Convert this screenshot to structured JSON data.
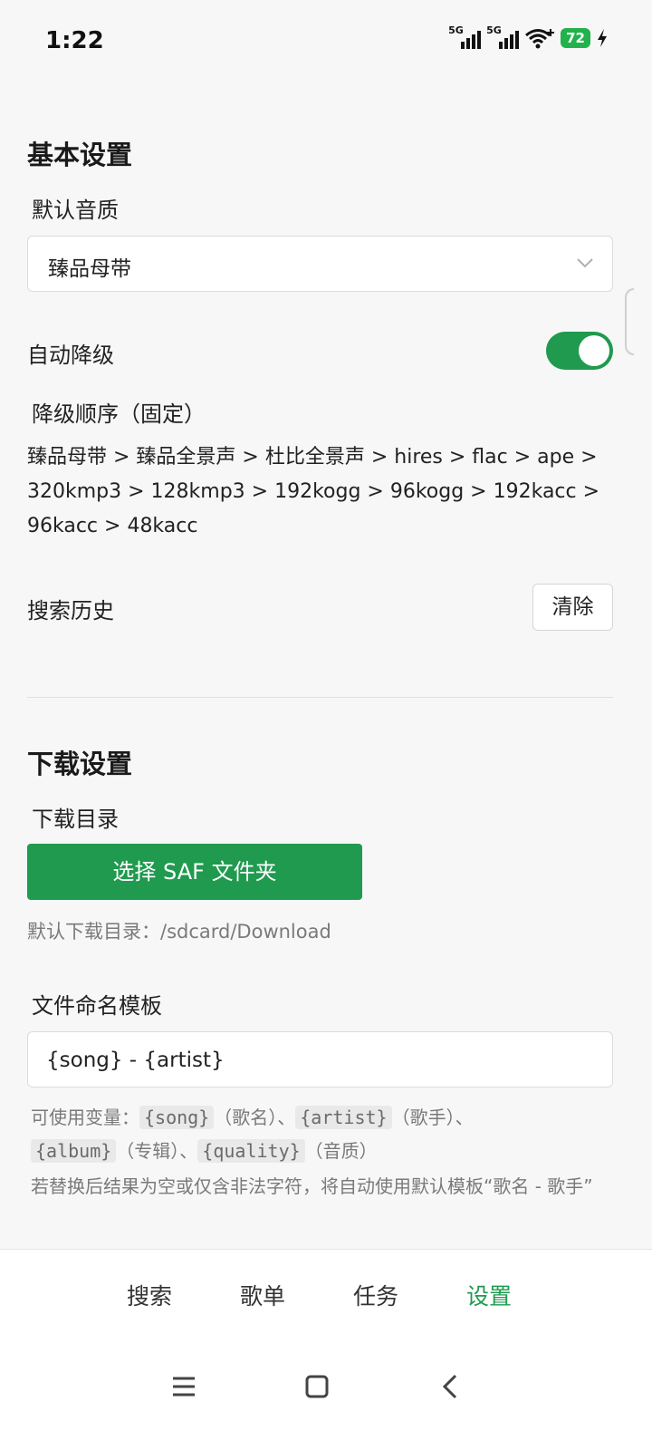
{
  "status_bar": {
    "time": "1:22",
    "sim1": "5G",
    "sim2": "5G",
    "battery": "72",
    "accent": "#21b24b"
  },
  "basic": {
    "title": "基本设置",
    "quality_label": "默认音质",
    "quality_value": "臻品母带",
    "auto_downgrade_label": "自动降级",
    "auto_downgrade_on": true,
    "downgrade_order_label": "降级顺序（固定）",
    "downgrade_order_lines": [
      "臻品母带 > 臻品全景声 > 杜比全景声 > hires > flac > ape >",
      "320kmp3 > 128kmp3 > 192kogg > 96kogg > 192kacc >",
      "96kacc > 48kacc"
    ],
    "search_history_label": "搜索历史",
    "clear_label": "清除"
  },
  "download": {
    "title": "下载设置",
    "dir_label": "下载目录",
    "choose_button": "选择 SAF 文件夹",
    "default_dir": "默认下载目录：/sdcard/Download",
    "naming_label": "文件命名模板",
    "naming_value": "{song} - {artist}",
    "vars_prefix": "可使用变量：",
    "var_song": "{song}",
    "var_song_desc": "（歌名）、",
    "var_artist": "{artist}",
    "var_artist_desc": "（歌手）、",
    "var_album": "{album}",
    "var_album_desc": "（专辑）、",
    "var_quality": "{quality}",
    "var_quality_desc": "（音质）",
    "warning": "若替换后结果为空或仅含非法字符，将自动使用默认模板“歌名 - 歌手”"
  },
  "bottom_nav": {
    "items": [
      {
        "label": "搜索"
      },
      {
        "label": "歌单"
      },
      {
        "label": "任务"
      },
      {
        "label": "设置",
        "active": true
      }
    ],
    "active_color": "#1f9a4f"
  },
  "system_nav": {
    "icons": [
      "menu-icon",
      "home-square-icon",
      "back-chevron-icon"
    ]
  }
}
